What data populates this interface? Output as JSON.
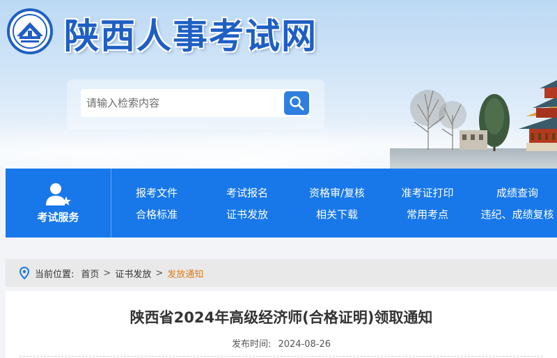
{
  "header": {
    "site_title": "陕西人事考试网"
  },
  "search": {
    "placeholder": "请输入检索内容",
    "icon": "search-icon"
  },
  "nav": {
    "service_label": "考试服务",
    "service_icon": "user-star-icon",
    "row1": [
      "报考文件",
      "考试报名",
      "资格审/复核",
      "准考证打印",
      "成绩查询"
    ],
    "row2": [
      "合格标准",
      "证书发放",
      "相关下载",
      "常用考点",
      "违纪、成绩复核"
    ]
  },
  "breadcrumb": {
    "icon": "location-pin-icon",
    "prefix": "当前位置:",
    "home": "首页",
    "section": "证书发放",
    "current": "发放通知",
    "separator": ">"
  },
  "article": {
    "title": "陕西省2024年高级经济师(合格证明)领取通知",
    "date_label": "发布时间:",
    "date": "2024-08-26"
  },
  "colors": {
    "brand_blue": "#1878ea",
    "title_blue": "#1f5fc4",
    "current_orange": "#e07a14"
  }
}
